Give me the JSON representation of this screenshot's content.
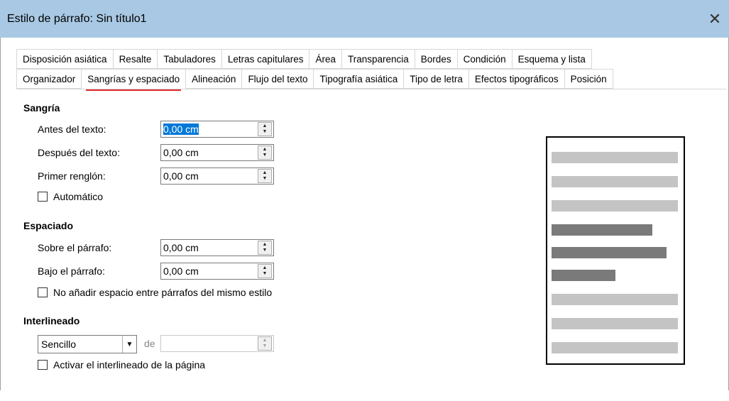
{
  "window": {
    "title": "Estilo de párrafo: Sin título1",
    "close": "✕"
  },
  "tabs_row1": [
    "Disposición asiática",
    "Resalte",
    "Tabuladores",
    "Letras capitulares",
    "Área",
    "Transparencia",
    "Bordes",
    "Condición",
    "Esquema y lista"
  ],
  "tabs_row2": [
    "Organizador",
    "Sangrías y espaciado",
    "Alineación",
    "Flujo del texto",
    "Tipografía asiática",
    "Tipo de letra",
    "Efectos tipográficos",
    "Posición"
  ],
  "active_tab": "Sangrías y espaciado",
  "indent": {
    "heading": "Sangría",
    "before_label": "Antes del texto:",
    "before_value": "0,00 cm",
    "after_label": "Después del texto:",
    "after_value": "0,00 cm",
    "first_label": "Primer renglón:",
    "first_value": "0,00 cm",
    "auto_label": "Automático"
  },
  "spacing": {
    "heading": "Espaciado",
    "above_label": "Sobre el párrafo:",
    "above_value": "0,00 cm",
    "below_label": "Bajo el párrafo:",
    "below_value": "0,00 cm",
    "no_space_label": "No añadir espacio entre párrafos del mismo estilo"
  },
  "linespacing": {
    "heading": "Interlineado",
    "select_value": "Sencillo",
    "of_label": "de",
    "page_label": "Activar el interlineado de la página"
  },
  "colors": {
    "titlebar": "#a8c8e3",
    "accent": "#e0282a",
    "bar_light": "#c4c4c4",
    "bar_dark": "#7a7a7a"
  }
}
